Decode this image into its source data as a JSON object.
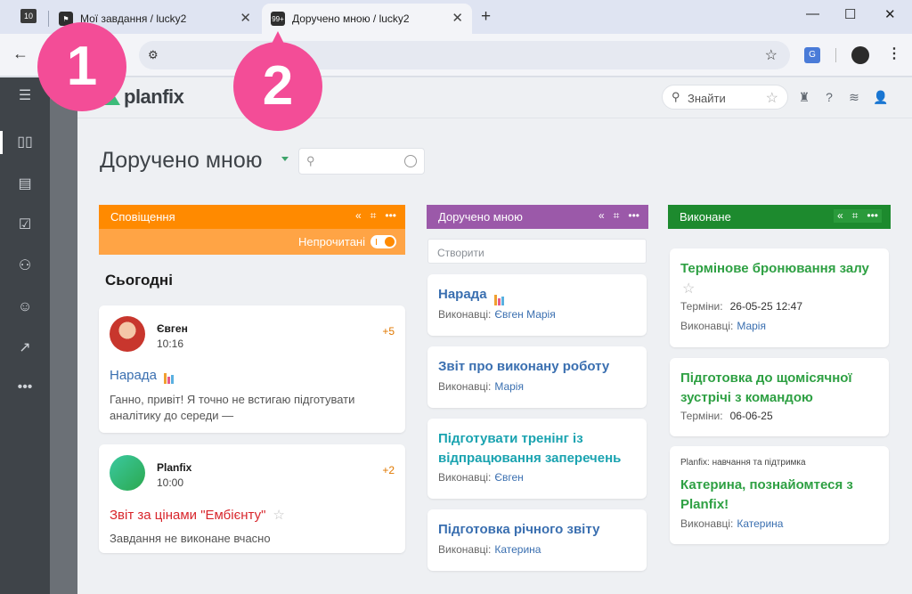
{
  "browser": {
    "tab_counter": "10",
    "tabs": [
      {
        "title": "Мої завдання / lucky2"
      },
      {
        "title": "Доручено мною / lucky2",
        "favicon_badge": "99+"
      }
    ],
    "translate_glyph": "G"
  },
  "app": {
    "logo": "planfix",
    "search": {
      "label": "Знайти"
    },
    "page_title": "Доручено мною"
  },
  "notifications_column": {
    "title": "Сповіщення",
    "unread_label": "Непрочитані",
    "section": "Сьогодні",
    "cards": [
      {
        "author": "Євген",
        "time": "10:16",
        "count": "+5",
        "subject": "Нарада",
        "body": "Ганно, привіт! Я точно не встигаю підготувати аналітику до середи —"
      },
      {
        "author": "Planfix",
        "time": "10:00",
        "count": "+2",
        "subject": "Звіт за цінами \"Ембієнту\"",
        "body": "Завдання не виконане вчасно"
      }
    ]
  },
  "assigned_column": {
    "title": "Доручено мною",
    "create_placeholder": "Створити",
    "cards": [
      {
        "title": "Нарада",
        "label": "Виконавці:",
        "assignees": "Євген  Марія"
      },
      {
        "title": "Звіт про виконану роботу",
        "label": "Виконавці:",
        "assignees": "Марія"
      },
      {
        "title_l1": "Підготувати тренінг із",
        "title_l2": "відпрацювання заперечень",
        "label": "Виконавці:",
        "assignees": "Євген"
      },
      {
        "title": "Підготовка річного звіту",
        "label": "Виконавці:",
        "assignees": "Катерина"
      }
    ]
  },
  "done_column": {
    "title": "Виконане",
    "cards": [
      {
        "title": "Термінове бронювання залу",
        "deadline_label": "Терміни:",
        "deadline": "26-05-25 12:47",
        "label": "Виконавці:",
        "assignees": "Марія"
      },
      {
        "title_l1": "Підготовка до щомісячної",
        "title_l2": "зустрічі з командою",
        "deadline_label": "Терміни:",
        "deadline": "06-06-25"
      },
      {
        "pretitle": "Planfix: навчання та підтримка",
        "title_l1": "Катерина, познайомтеся з",
        "title_l2": "Planfix!",
        "label": "Виконавці:",
        "assignees": "Катерина"
      }
    ]
  },
  "overlay": {
    "badge_1": "1",
    "badge_2": "2"
  },
  "colors": {
    "notif": "#ff8a00",
    "assigned": "#9b59a9",
    "done": "#1d8a2e",
    "link_blue": "#3a6fb0",
    "teal": "#1aa3b0",
    "green": "#2ea043",
    "badge": "#f34d97"
  }
}
